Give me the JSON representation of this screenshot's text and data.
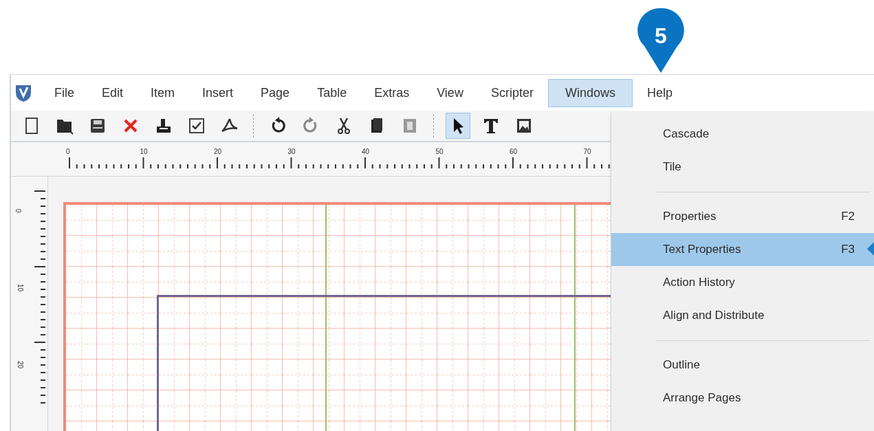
{
  "callout": {
    "number": "5"
  },
  "menu_bar": [
    {
      "label": "File",
      "selected": false
    },
    {
      "label": "Edit",
      "selected": false
    },
    {
      "label": "Item",
      "selected": false
    },
    {
      "label": "Insert",
      "selected": false
    },
    {
      "label": "Page",
      "selected": false
    },
    {
      "label": "Table",
      "selected": false
    },
    {
      "label": "Extras",
      "selected": false
    },
    {
      "label": "View",
      "selected": false
    },
    {
      "label": "Scripter",
      "selected": false
    },
    {
      "label": "Windows",
      "selected": true
    },
    {
      "label": "Help",
      "selected": false
    }
  ],
  "toolbar": [
    {
      "kind": "new",
      "selected": false
    },
    {
      "kind": "open",
      "selected": false
    },
    {
      "kind": "save",
      "selected": false
    },
    {
      "kind": "close",
      "selected": false
    },
    {
      "kind": "print",
      "selected": false
    },
    {
      "kind": "preflight",
      "selected": false
    },
    {
      "kind": "pdf",
      "selected": false
    },
    {
      "kind": "separator"
    },
    {
      "kind": "undo",
      "selected": false
    },
    {
      "kind": "redo",
      "selected": false
    },
    {
      "kind": "cut",
      "selected": false
    },
    {
      "kind": "copy",
      "selected": false
    },
    {
      "kind": "paste",
      "selected": false
    },
    {
      "kind": "separator"
    },
    {
      "kind": "select",
      "selected": true
    },
    {
      "kind": "text",
      "selected": false
    },
    {
      "kind": "image",
      "selected": false
    }
  ],
  "rulers": {
    "horizontal": [
      "0",
      "10",
      "20",
      "30",
      "40",
      "50",
      "60",
      "70"
    ],
    "vertical": [
      "0",
      "10",
      "20"
    ]
  },
  "windows_menu": [
    {
      "kind": "item",
      "label": "Cascade",
      "selected": false
    },
    {
      "kind": "item",
      "label": "Tile",
      "selected": false
    },
    {
      "kind": "separator"
    },
    {
      "kind": "item",
      "label": "Properties",
      "shortcut": "F2",
      "selected": false
    },
    {
      "kind": "item",
      "label": "Text Properties",
      "shortcut": "F3",
      "selected": true
    },
    {
      "kind": "item",
      "label": "Action History",
      "selected": false
    },
    {
      "kind": "item",
      "label": "Align and Distribute",
      "selected": false
    },
    {
      "kind": "separator"
    },
    {
      "kind": "item",
      "label": "Outline",
      "selected": false
    },
    {
      "kind": "item",
      "label": "Arrange Pages",
      "selected": false
    }
  ]
}
